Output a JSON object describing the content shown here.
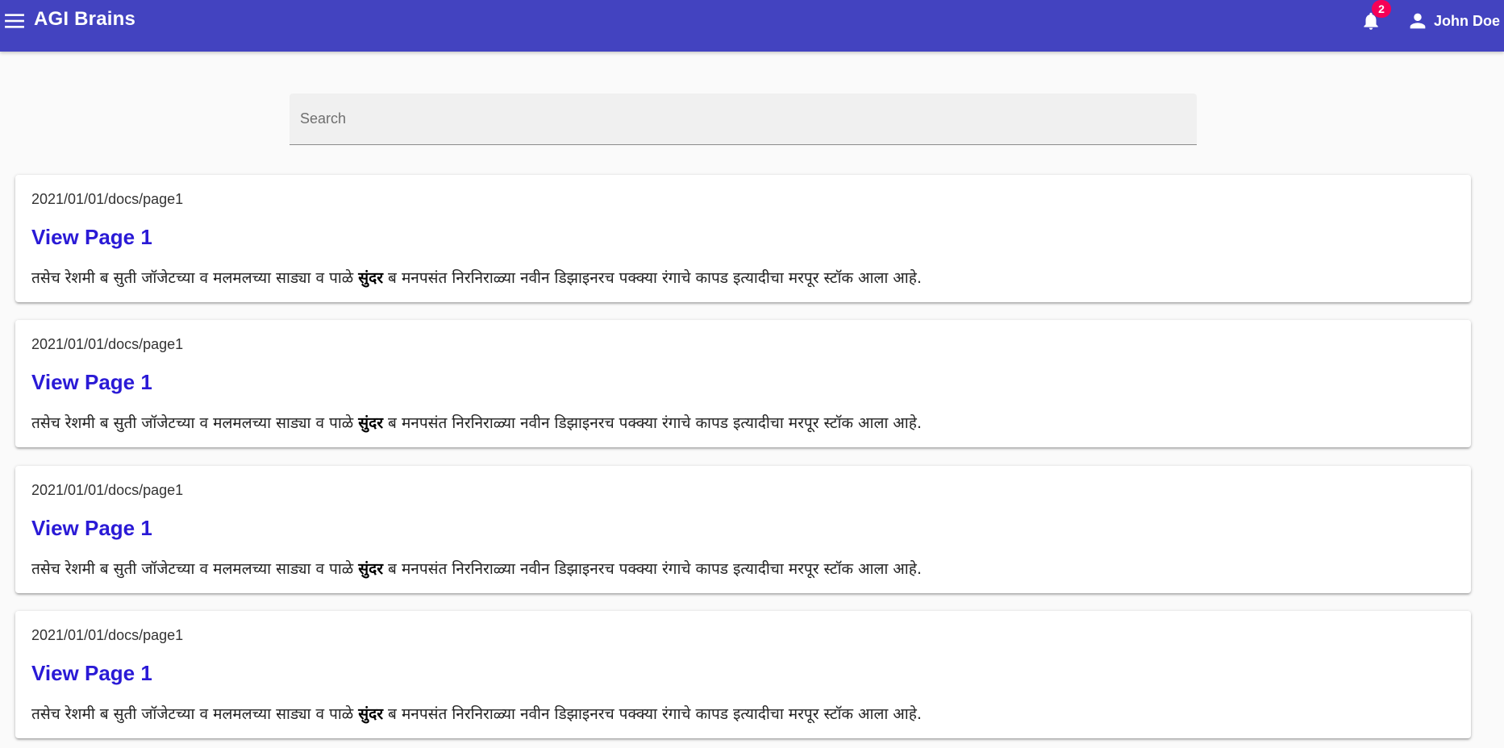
{
  "header": {
    "title": "AGI Brains",
    "notification_count": "2",
    "user_name": "John Doe",
    "colors": {
      "bar": "#4343c0",
      "badge": "#f50057"
    },
    "icons": [
      "menu-icon",
      "bell-icon",
      "person-icon"
    ]
  },
  "search": {
    "placeholder": "Search",
    "value": ""
  },
  "results": [
    {
      "path": "2021/01/01/docs/page1",
      "title": "View Page 1",
      "snippet_before": "तसेच रेशमी ब सुती जॉजेटच्या व मलमलच्या साड्या व पाळे ",
      "snippet_bold": "सुंदर",
      "snippet_after": " ब मनपसंत निरनिराळ्या नवीन डिझाइनरच पक्क्या रंगाचे कापड इत्यादीचा मरपूर स्टॉक आला आहे."
    },
    {
      "path": "2021/01/01/docs/page1",
      "title": "View Page 1",
      "snippet_before": "तसेच रेशमी ब सुती जॉजेटच्या व मलमलच्या साड्या व पाळे ",
      "snippet_bold": "सुंदर",
      "snippet_after": " ब मनपसंत निरनिराळ्या नवीन डिझाइनरच पक्क्या रंगाचे कापड इत्यादीचा मरपूर स्टॉक आला आहे."
    },
    {
      "path": "2021/01/01/docs/page1",
      "title": "View Page 1",
      "snippet_before": "तसेच रेशमी ब सुती जॉजेटच्या व मलमलच्या साड्या व पाळे ",
      "snippet_bold": "सुंदर",
      "snippet_after": " ब मनपसंत निरनिराळ्या नवीन डिझाइनरच पक्क्या रंगाचे कापड इत्यादीचा मरपूर स्टॉक आला आहे."
    },
    {
      "path": "2021/01/01/docs/page1",
      "title": "View Page 1",
      "snippet_before": "तसेच रेशमी ब सुती जॉजेटच्या व मलमलच्या साड्या व पाळे ",
      "snippet_bold": "सुंदर",
      "snippet_after": " ब मनपसंत निरनिराळ्या नवीन डिझाइनरच पक्क्या रंगाचे कापड इत्यादीचा मरपूर स्टॉक आला आहे."
    }
  ]
}
